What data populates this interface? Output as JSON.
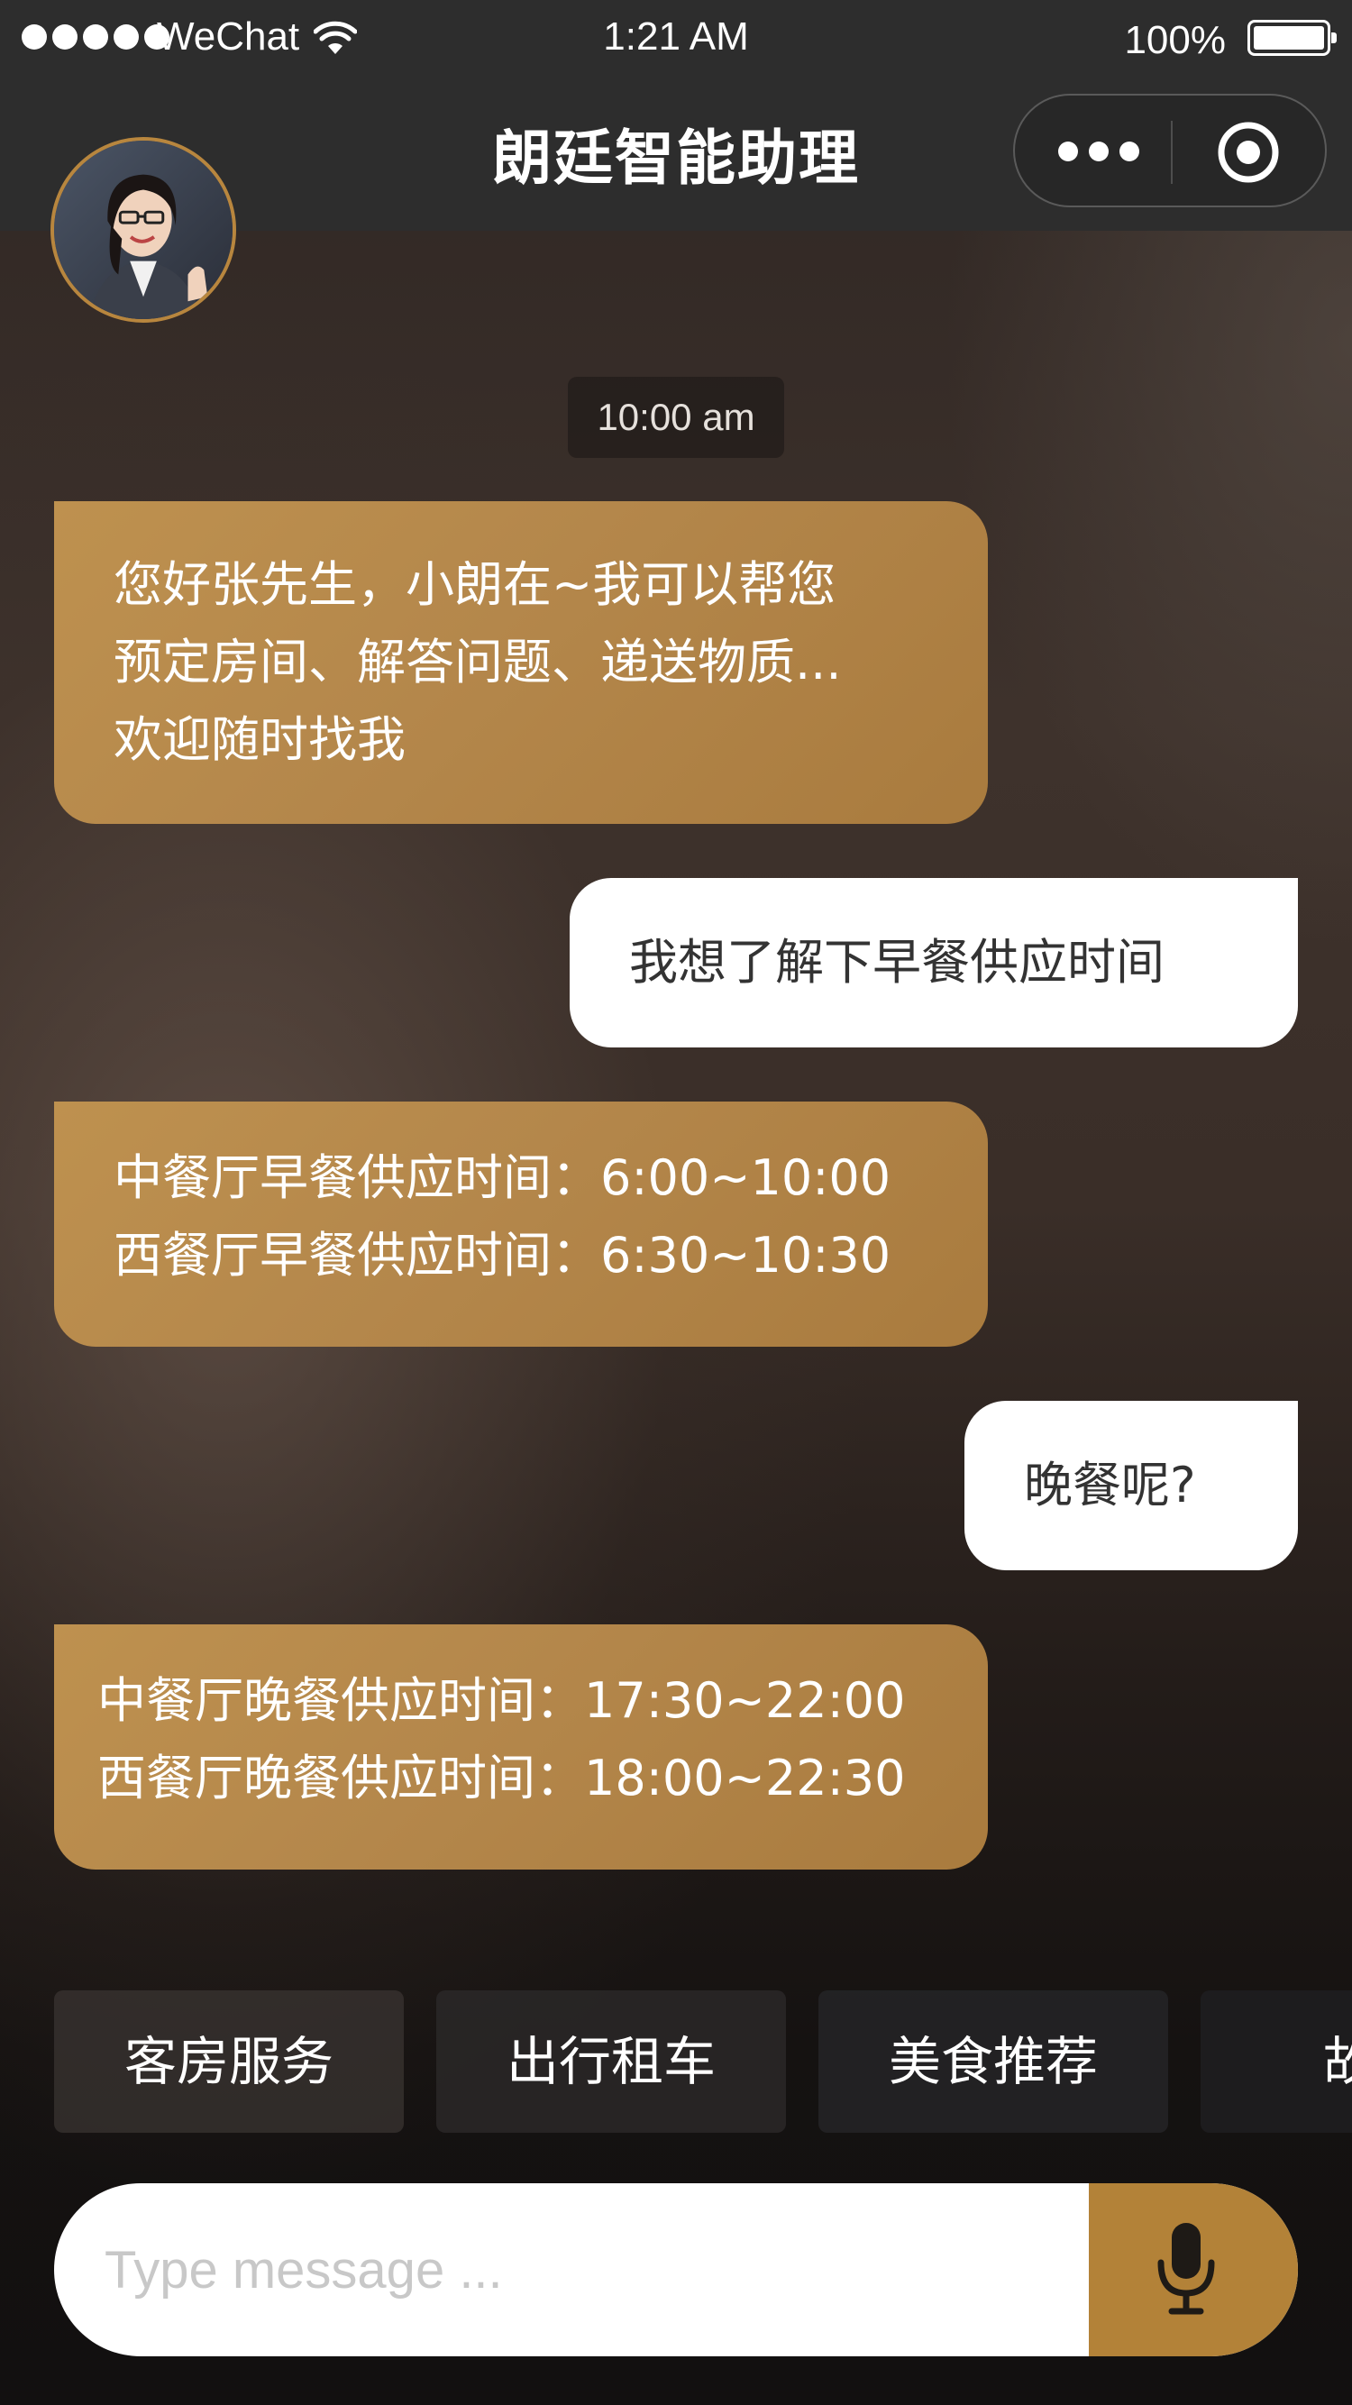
{
  "status_bar": {
    "carrier": "WeChat",
    "time": "1:21 AM",
    "battery": "100%"
  },
  "nav": {
    "title": "朗廷智能助理",
    "more_icon": "more-dots-icon",
    "close_icon": "target-circle-icon"
  },
  "chat": {
    "timestamp": "10:00 am",
    "messages": [
      {
        "from": "bot",
        "lines": [
          "您好张先生，小朗在~我可以帮您",
          "预定房间、解答问题、递送物质...",
          "欢迎随时找我"
        ]
      },
      {
        "from": "user",
        "lines": [
          "我想了解下早餐供应时间"
        ]
      },
      {
        "from": "bot",
        "lines": [
          "中餐厅早餐供应时间：6:00~10:00",
          "西餐厅早餐供应时间：6:30~10:30"
        ]
      },
      {
        "from": "user",
        "lines": [
          "晚餐呢?"
        ]
      },
      {
        "from": "bot",
        "lines": [
          "中餐厅晚餐供应时间：17:30~22:00",
          "西餐厅晚餐供应时间：18:00~22:30"
        ]
      }
    ]
  },
  "quick_replies": [
    "客房服务",
    "出行租车",
    "美食推荐",
    "故障"
  ],
  "input": {
    "placeholder": "Type message ...",
    "value": "",
    "mic_icon": "microphone-icon"
  },
  "colors": {
    "accent_gold": "#b38238",
    "bot_bubble": "#b4874b",
    "nav_bg": "#2d2d2d"
  }
}
